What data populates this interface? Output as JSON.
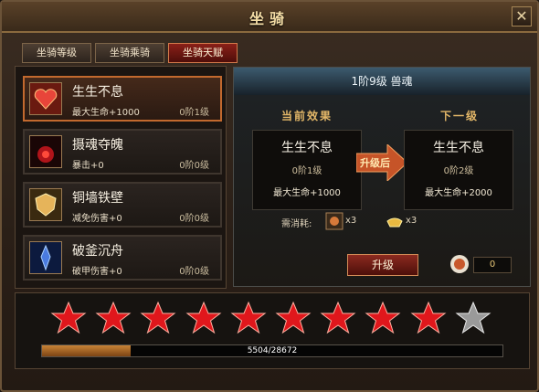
{
  "window": {
    "title": "坐骑",
    "close_glyph": "✕"
  },
  "tabs": [
    {
      "label": "坐骑等级",
      "active": false
    },
    {
      "label": "坐骑乘骑",
      "active": false
    },
    {
      "label": "坐骑天赋",
      "active": true
    }
  ],
  "skills": [
    {
      "name": "生生不息",
      "effect": "最大生命+1000",
      "level": "0阶1级",
      "icon": "heart-icon",
      "selected": true
    },
    {
      "name": "摄魂夺魄",
      "effect": "暴击+0",
      "level": "0阶0级",
      "icon": "soul-icon",
      "selected": false
    },
    {
      "name": "铜墙铁壁",
      "effect": "减免伤害+0",
      "level": "0阶0级",
      "icon": "shield-icon",
      "selected": false
    },
    {
      "name": "破釜沉舟",
      "effect": "破甲伤害+0",
      "level": "0阶0级",
      "icon": "armor-break-icon",
      "selected": false
    }
  ],
  "detail": {
    "header": "1阶9级  兽魂",
    "current_label": "当前效果",
    "next_label": "下一级",
    "arrow_text": "升级后",
    "current": {
      "name": "生生不息",
      "level": "0阶1级",
      "effect": "最大生命+1000"
    },
    "next": {
      "name": "生生不息",
      "level": "0阶2级",
      "effect": "最大生命+2000"
    },
    "cost_label": "需消耗:",
    "cost_items": [
      {
        "icon": "material-icon",
        "count": "x3"
      },
      {
        "icon": "gold-ingot-icon",
        "count": "x3"
      }
    ],
    "upgrade_button": "升级",
    "orb_count": "0"
  },
  "stars": {
    "total": 10,
    "filled": 9
  },
  "progress": {
    "text": "5504/28672",
    "current": 5504,
    "max": 28672
  },
  "colors": {
    "accent": "#c2692e",
    "star_red": "#e0171c",
    "star_gray": "#9a9a9a",
    "progress": "#c78336"
  }
}
